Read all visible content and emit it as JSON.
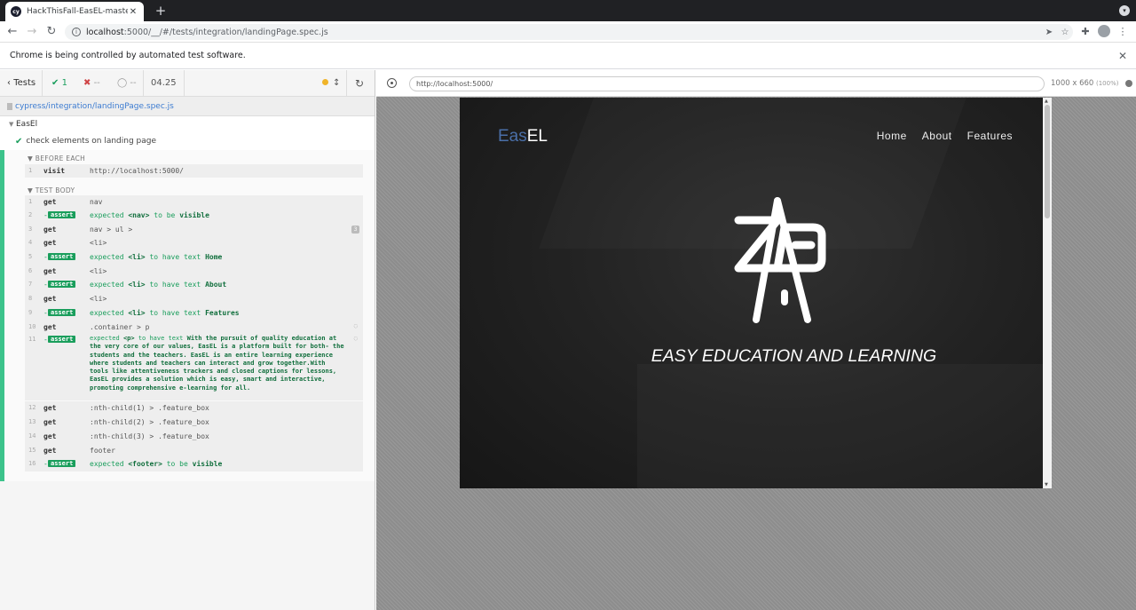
{
  "browser": {
    "tab_title": "HackThisFall-EasEL-master-ba",
    "tab_favicon": "cy",
    "tab_close": "✕",
    "new_tab": "+",
    "url_host": "localhost",
    "url_rest": ":5000/__/#/tests/integration/landingPage.spec.js",
    "infobar_text": "Chrome is being controlled by automated test software.",
    "infobar_close": "✕"
  },
  "reporter": {
    "back_label": "Tests",
    "passed": "1",
    "failed": "--",
    "pending": "--",
    "duration": "04.25",
    "spec_path": "cypress/integration/landingPage.spec.js",
    "suite_title": "EasEl",
    "test_title": "check elements on landing page",
    "before_each_label": "BEFORE EACH",
    "test_body_label": "TEST BODY",
    "before_each": {
      "num": "1",
      "name": "visit",
      "message": "http://localhost:5000/"
    },
    "commands": [
      {
        "num": "1",
        "name": "get",
        "message": "nav"
      },
      {
        "num": "2",
        "assert": "assert",
        "message": "expected",
        "subject": "<nav>",
        "verb": "to be",
        "target": "visible"
      },
      {
        "num": "3",
        "name": "get",
        "message": "nav > ul >",
        "badge": "3"
      },
      {
        "num": "4",
        "name": "get",
        "message": "<li>"
      },
      {
        "num": "5",
        "assert": "assert",
        "message": "expected",
        "subject": "<li>",
        "verb": "to have text",
        "target": "Home"
      },
      {
        "num": "6",
        "name": "get",
        "message": "<li>"
      },
      {
        "num": "7",
        "assert": "assert",
        "message": "expected",
        "subject": "<li>",
        "verb": "to have text",
        "target": "About"
      },
      {
        "num": "8",
        "name": "get",
        "message": "<li>"
      },
      {
        "num": "9",
        "assert": "assert",
        "message": "expected",
        "subject": "<li>",
        "verb": "to have text",
        "target": "Features"
      },
      {
        "num": "10",
        "name": "get",
        "message": ".container > p"
      },
      {
        "num": "11",
        "assert": "assert",
        "message": "expected",
        "subject": "<p>",
        "verb": "to have text",
        "target": "With the pursuit of quality education at the very core of our values, EasEL is a platform built for both- the students and the teachers. EasEL is an entire learning experience where students and teachers can interact and grow together.With tools like attentiveness trackers and closed captions for lessons, EasEL provides a solution which is easy, smart and interactive, promoting comprehensive e-learning for all."
      },
      {
        "num": "12",
        "name": "get",
        "message": ":nth-child(1) > .feature_box"
      },
      {
        "num": "13",
        "name": "get",
        "message": ":nth-child(2) > .feature_box"
      },
      {
        "num": "14",
        "name": "get",
        "message": ":nth-child(3) > .feature_box"
      },
      {
        "num": "15",
        "name": "get",
        "message": "footer"
      },
      {
        "num": "16",
        "assert": "assert",
        "message": "expected",
        "subject": "<footer>",
        "verb": "to be",
        "target": "visible"
      }
    ]
  },
  "preview": {
    "url": "http://localhost:5000/",
    "viewport": "1000 x 660",
    "scale": "(100%)"
  },
  "app": {
    "logo_part1": "Eas",
    "logo_part2": "EL",
    "nav": [
      "Home",
      "About",
      "Features"
    ],
    "tagline": "EASY EDUCATION AND LEARNING"
  },
  "colors": {
    "pass": "#1a9e5c",
    "fail": "#cf4446",
    "accent_blue": "#3d7cd1",
    "logo_blue": "#4a6fa8"
  }
}
